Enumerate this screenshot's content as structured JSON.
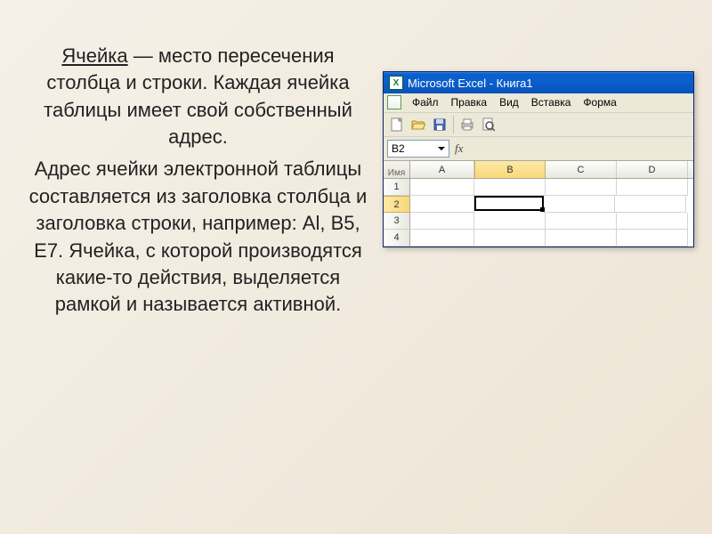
{
  "text": {
    "term": "Ячейка",
    "para1_rest": " — место пересечения столбца и строки. Каждая ячейка таблицы имеет свой собственный адрес.",
    "para2": "Адрес ячейки электронной таблицы составляется из заголовка столбца и заголовка строки, например: Al, B5, E7. Ячейка, с которой производятся какие-то действия, выделяется рамкой и называется активной."
  },
  "excel": {
    "title": "Microsoft Excel - Книга1",
    "icon_letter": "X",
    "menu": {
      "file": "Файл",
      "edit": "Правка",
      "view": "Вид",
      "insert": "Вставка",
      "format": "Форма"
    },
    "name_box_label": "Имя",
    "name_box_value": "B2",
    "fx": "fx",
    "columns": [
      "A",
      "B",
      "C",
      "D"
    ],
    "rows": [
      "1",
      "2",
      "3",
      "4"
    ],
    "selected_cell": "B2"
  }
}
